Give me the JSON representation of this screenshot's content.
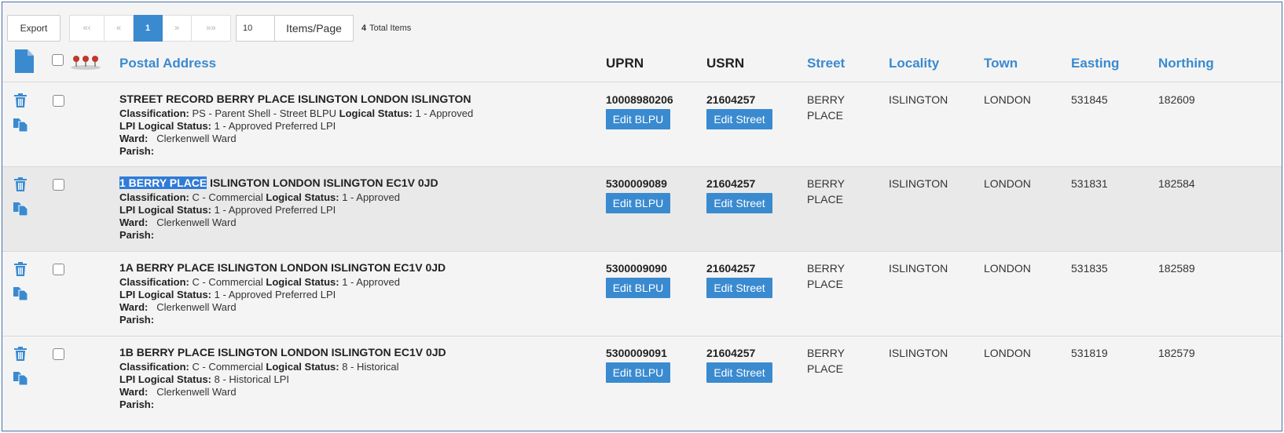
{
  "toolbar": {
    "export_label": "Export",
    "pager": {
      "first_label": "«‹",
      "prev_label": "«",
      "current_page": "1",
      "next_label": "»",
      "last_label": "»»"
    },
    "items_per_page_value": "10",
    "items_per_page_label": "Items/Page",
    "total_count": "4",
    "total_label": "Total Items"
  },
  "header": {
    "postal_address": "Postal Address",
    "uprn": "UPRN",
    "usrn": "USRN",
    "street": "Street",
    "locality": "Locality",
    "town": "Town",
    "easting": "Easting",
    "northing": "Northing"
  },
  "labels": {
    "classification": "Classification:",
    "logical_status": "Logical Status:",
    "lpi_logical_status": "LPI Logical Status:",
    "ward": "Ward:",
    "parish": "Parish:",
    "edit_blpu": "Edit BLPU",
    "edit_street": "Edit Street"
  },
  "rows": [
    {
      "address_highlight": "",
      "address_rest": "STREET RECORD BERRY PLACE ISLINGTON LONDON ISLINGTON",
      "classification": "PS - Parent Shell - Street BLPU",
      "logical_status": "1 - Approved",
      "lpi_logical_status": "1 - Approved Preferred LPI",
      "ward": "Clerkenwell Ward",
      "parish": "",
      "uprn": "10008980206",
      "usrn": "21604257",
      "street_line1": "BERRY",
      "street_line2": "PLACE",
      "locality": "ISLINGTON",
      "town": "LONDON",
      "easting": "531845",
      "northing": "182609"
    },
    {
      "address_highlight": "1 BERRY PLACE",
      "address_rest": " ISLINGTON LONDON ISLINGTON EC1V 0JD",
      "classification": "C - Commercial",
      "logical_status": "1 - Approved",
      "lpi_logical_status": "1 - Approved Preferred LPI",
      "ward": "Clerkenwell Ward",
      "parish": "",
      "uprn": "5300009089",
      "usrn": "21604257",
      "street_line1": "BERRY",
      "street_line2": "PLACE",
      "locality": "ISLINGTON",
      "town": "LONDON",
      "easting": "531831",
      "northing": "182584"
    },
    {
      "address_highlight": "",
      "address_rest": "1A BERRY PLACE ISLINGTON LONDON ISLINGTON EC1V 0JD",
      "classification": "C - Commercial",
      "logical_status": "1 - Approved",
      "lpi_logical_status": "1 - Approved Preferred LPI",
      "ward": "Clerkenwell Ward",
      "parish": "",
      "uprn": "5300009090",
      "usrn": "21604257",
      "street_line1": "BERRY",
      "street_line2": "PLACE",
      "locality": "ISLINGTON",
      "town": "LONDON",
      "easting": "531835",
      "northing": "182589"
    },
    {
      "address_highlight": "",
      "address_rest": "1B BERRY PLACE ISLINGTON LONDON ISLINGTON EC1V 0JD",
      "classification": "C - Commercial",
      "logical_status": "8 - Historical",
      "lpi_logical_status": "8 - Historical LPI",
      "ward": "Clerkenwell Ward",
      "parish": "",
      "uprn": "5300009091",
      "usrn": "21604257",
      "street_line1": "BERRY",
      "street_line2": "PLACE",
      "locality": "ISLINGTON",
      "town": "LONDON",
      "easting": "531819",
      "northing": "182579"
    }
  ],
  "colors": {
    "accent": "#3a8ad0",
    "selection": "#2f7bd6",
    "row_alt": "#e9e9e9"
  },
  "icons": [
    "document-icon",
    "pins-icon",
    "trash-icon",
    "copy-icon"
  ]
}
